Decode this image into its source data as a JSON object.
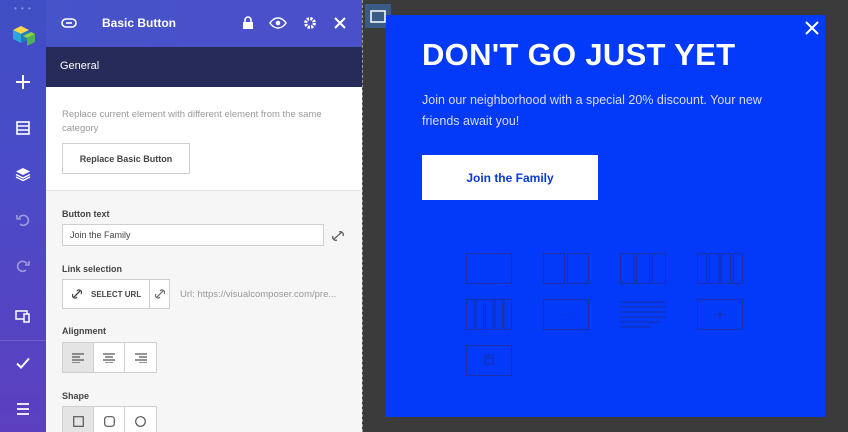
{
  "panel": {
    "title": "Basic Button",
    "tab": "General",
    "helper_text": "Replace current element with different element from the same category",
    "replace_button": "Replace Basic Button",
    "button_text_label": "Button text",
    "button_text_value": "Join the Family",
    "link_selection_label": "Link selection",
    "select_url_label": "SELECT URL",
    "url_value": "Url: https://visualcomposer.com/pre...",
    "alignment_label": "Alignment",
    "shape_label": "Shape"
  },
  "popup": {
    "heading": "DON'T GO JUST YET",
    "description": "Join our neighborhood with a special 20% discount. Your new friends await you!",
    "cta_label": "Join the Family"
  },
  "colors": {
    "popup_bg": "#0339f8",
    "panel_header": "#4653c9",
    "tab_bar": "#262b5a",
    "canvas_bg": "#3b3b3b"
  },
  "icons": {
    "rail": [
      "logo-icon",
      "plus-icon",
      "layout-icon",
      "layers-icon",
      "undo-icon",
      "redo-icon",
      "responsive-icon",
      "check-icon",
      "menu-icon"
    ],
    "header": [
      "element-icon",
      "lock-icon",
      "eye-icon",
      "gear-icon",
      "close-icon"
    ]
  }
}
